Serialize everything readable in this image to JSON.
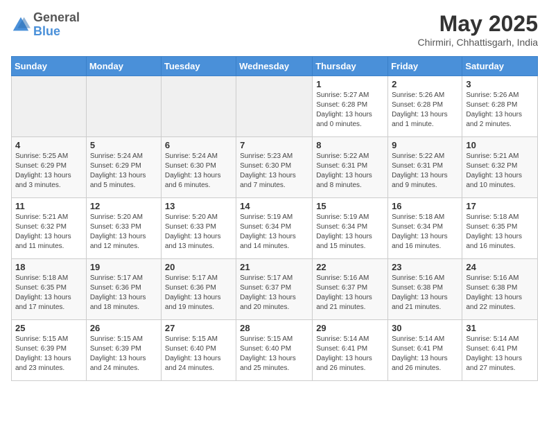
{
  "header": {
    "logo_general": "General",
    "logo_blue": "Blue",
    "month_title": "May 2025",
    "location": "Chirmiri, Chhattisgarh, India"
  },
  "weekdays": [
    "Sunday",
    "Monday",
    "Tuesday",
    "Wednesday",
    "Thursday",
    "Friday",
    "Saturday"
  ],
  "weeks": [
    [
      {
        "day": "",
        "info": ""
      },
      {
        "day": "",
        "info": ""
      },
      {
        "day": "",
        "info": ""
      },
      {
        "day": "",
        "info": ""
      },
      {
        "day": "1",
        "info": "Sunrise: 5:27 AM\nSunset: 6:28 PM\nDaylight: 13 hours\nand 0 minutes."
      },
      {
        "day": "2",
        "info": "Sunrise: 5:26 AM\nSunset: 6:28 PM\nDaylight: 13 hours\nand 1 minute."
      },
      {
        "day": "3",
        "info": "Sunrise: 5:26 AM\nSunset: 6:28 PM\nDaylight: 13 hours\nand 2 minutes."
      }
    ],
    [
      {
        "day": "4",
        "info": "Sunrise: 5:25 AM\nSunset: 6:29 PM\nDaylight: 13 hours\nand 3 minutes."
      },
      {
        "day": "5",
        "info": "Sunrise: 5:24 AM\nSunset: 6:29 PM\nDaylight: 13 hours\nand 5 minutes."
      },
      {
        "day": "6",
        "info": "Sunrise: 5:24 AM\nSunset: 6:30 PM\nDaylight: 13 hours\nand 6 minutes."
      },
      {
        "day": "7",
        "info": "Sunrise: 5:23 AM\nSunset: 6:30 PM\nDaylight: 13 hours\nand 7 minutes."
      },
      {
        "day": "8",
        "info": "Sunrise: 5:22 AM\nSunset: 6:31 PM\nDaylight: 13 hours\nand 8 minutes."
      },
      {
        "day": "9",
        "info": "Sunrise: 5:22 AM\nSunset: 6:31 PM\nDaylight: 13 hours\nand 9 minutes."
      },
      {
        "day": "10",
        "info": "Sunrise: 5:21 AM\nSunset: 6:32 PM\nDaylight: 13 hours\nand 10 minutes."
      }
    ],
    [
      {
        "day": "11",
        "info": "Sunrise: 5:21 AM\nSunset: 6:32 PM\nDaylight: 13 hours\nand 11 minutes."
      },
      {
        "day": "12",
        "info": "Sunrise: 5:20 AM\nSunset: 6:33 PM\nDaylight: 13 hours\nand 12 minutes."
      },
      {
        "day": "13",
        "info": "Sunrise: 5:20 AM\nSunset: 6:33 PM\nDaylight: 13 hours\nand 13 minutes."
      },
      {
        "day": "14",
        "info": "Sunrise: 5:19 AM\nSunset: 6:34 PM\nDaylight: 13 hours\nand 14 minutes."
      },
      {
        "day": "15",
        "info": "Sunrise: 5:19 AM\nSunset: 6:34 PM\nDaylight: 13 hours\nand 15 minutes."
      },
      {
        "day": "16",
        "info": "Sunrise: 5:18 AM\nSunset: 6:34 PM\nDaylight: 13 hours\nand 16 minutes."
      },
      {
        "day": "17",
        "info": "Sunrise: 5:18 AM\nSunset: 6:35 PM\nDaylight: 13 hours\nand 16 minutes."
      }
    ],
    [
      {
        "day": "18",
        "info": "Sunrise: 5:18 AM\nSunset: 6:35 PM\nDaylight: 13 hours\nand 17 minutes."
      },
      {
        "day": "19",
        "info": "Sunrise: 5:17 AM\nSunset: 6:36 PM\nDaylight: 13 hours\nand 18 minutes."
      },
      {
        "day": "20",
        "info": "Sunrise: 5:17 AM\nSunset: 6:36 PM\nDaylight: 13 hours\nand 19 minutes."
      },
      {
        "day": "21",
        "info": "Sunrise: 5:17 AM\nSunset: 6:37 PM\nDaylight: 13 hours\nand 20 minutes."
      },
      {
        "day": "22",
        "info": "Sunrise: 5:16 AM\nSunset: 6:37 PM\nDaylight: 13 hours\nand 21 minutes."
      },
      {
        "day": "23",
        "info": "Sunrise: 5:16 AM\nSunset: 6:38 PM\nDaylight: 13 hours\nand 21 minutes."
      },
      {
        "day": "24",
        "info": "Sunrise: 5:16 AM\nSunset: 6:38 PM\nDaylight: 13 hours\nand 22 minutes."
      }
    ],
    [
      {
        "day": "25",
        "info": "Sunrise: 5:15 AM\nSunset: 6:39 PM\nDaylight: 13 hours\nand 23 minutes."
      },
      {
        "day": "26",
        "info": "Sunrise: 5:15 AM\nSunset: 6:39 PM\nDaylight: 13 hours\nand 24 minutes."
      },
      {
        "day": "27",
        "info": "Sunrise: 5:15 AM\nSunset: 6:40 PM\nDaylight: 13 hours\nand 24 minutes."
      },
      {
        "day": "28",
        "info": "Sunrise: 5:15 AM\nSunset: 6:40 PM\nDaylight: 13 hours\nand 25 minutes."
      },
      {
        "day": "29",
        "info": "Sunrise: 5:14 AM\nSunset: 6:41 PM\nDaylight: 13 hours\nand 26 minutes."
      },
      {
        "day": "30",
        "info": "Sunrise: 5:14 AM\nSunset: 6:41 PM\nDaylight: 13 hours\nand 26 minutes."
      },
      {
        "day": "31",
        "info": "Sunrise: 5:14 AM\nSunset: 6:41 PM\nDaylight: 13 hours\nand 27 minutes."
      }
    ]
  ]
}
